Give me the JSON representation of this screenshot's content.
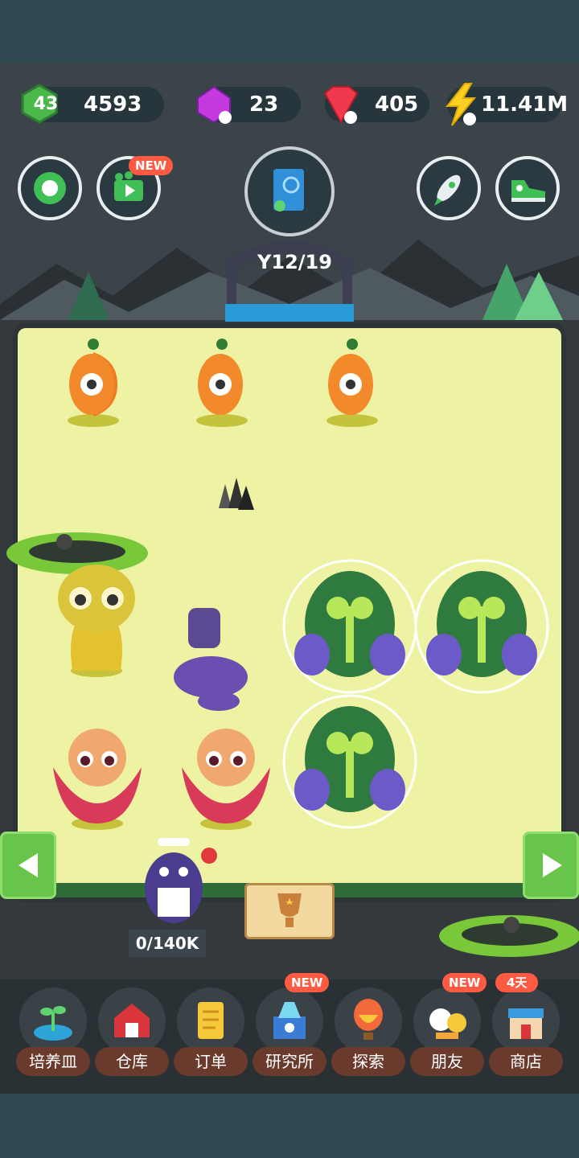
{
  "resources": {
    "level": "43",
    "coins": "4593",
    "gems": "23",
    "rubies": "405",
    "energy": "11.41M"
  },
  "top_buttons": {
    "video_badge": "NEW"
  },
  "progress": {
    "label": "12/19"
  },
  "board": {
    "counter": "0/140K"
  },
  "nav": {
    "items": [
      {
        "label": "培养皿",
        "badge": ""
      },
      {
        "label": "仓库",
        "badge": ""
      },
      {
        "label": "订单",
        "badge": ""
      },
      {
        "label": "研究所",
        "badge": "NEW"
      },
      {
        "label": "探索",
        "badge": ""
      },
      {
        "label": "朋友",
        "badge": "NEW"
      },
      {
        "label": "商店",
        "badge": "4天"
      }
    ]
  },
  "colors": {
    "board_bg": "#eef3a3",
    "accent_green": "#68c54a",
    "badge_red": "#ff5a42",
    "label_brown": "#6a3a2d"
  }
}
